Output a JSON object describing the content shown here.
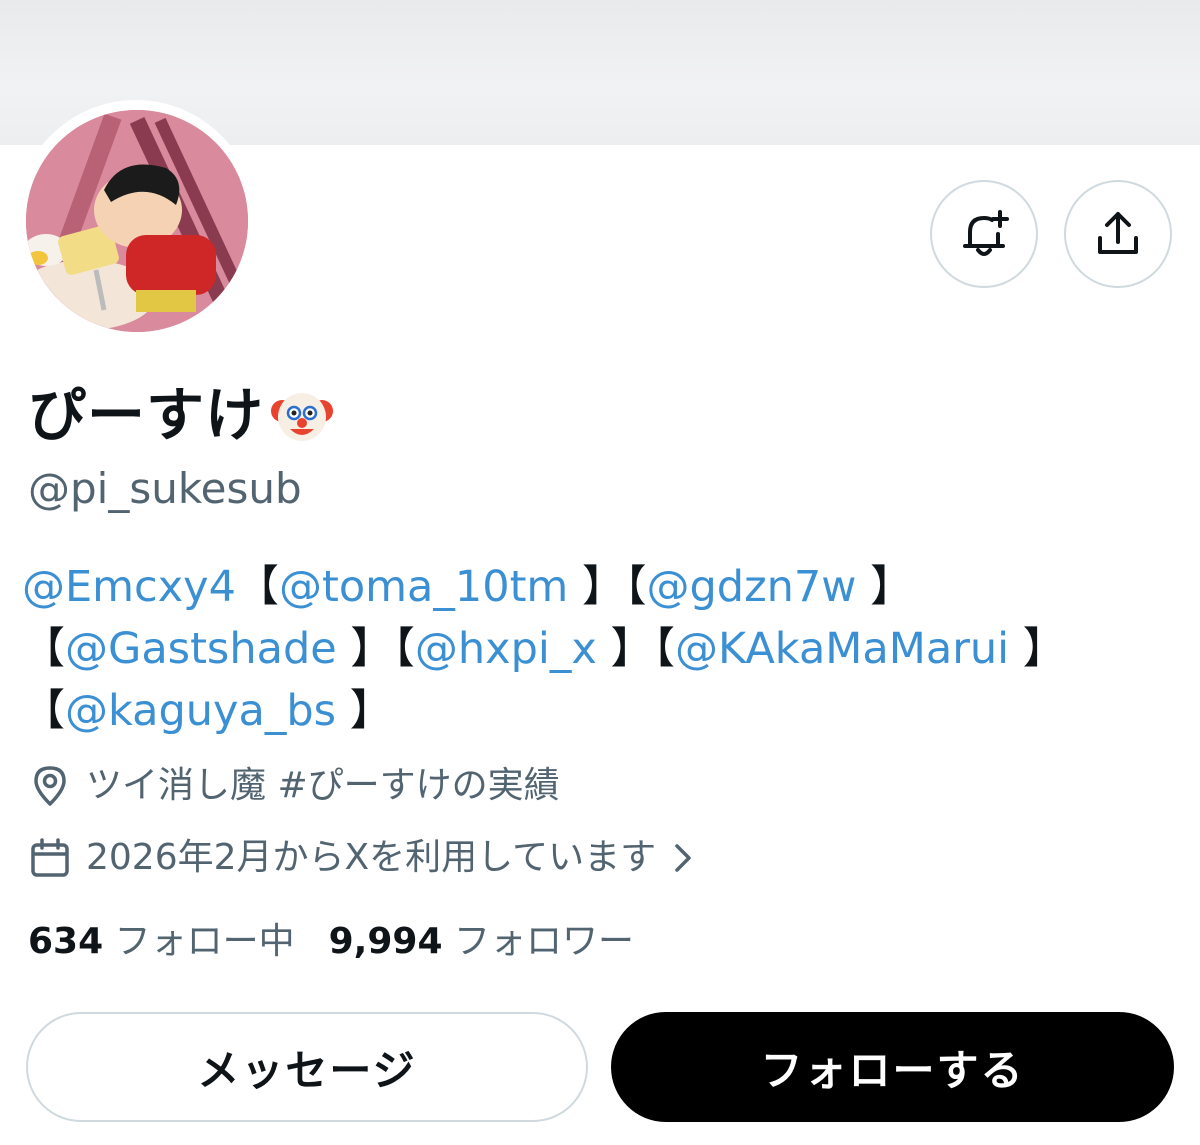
{
  "profile": {
    "display_name": "ぴーすけ",
    "display_emoji": "clown-face-emoji",
    "handle": "@pi_sukesub",
    "location": "ツイ消し魔 #ぴーすけの実績",
    "joined": "2026年2月からXを利用しています"
  },
  "bio": {
    "mentions": [
      "@Emcxy4",
      "@toma_10tm",
      "@gdzn7w",
      "@Gastshade",
      "@hxpi_x",
      "@KAkaMaMarui",
      "@kaguya_bs"
    ],
    "bracket_open": "【",
    "bracket_close": "】"
  },
  "stats": {
    "following_count": "634",
    "following_label": "フォロー中",
    "followers_count": "9,994",
    "followers_label": "フォロワー"
  },
  "actions": {
    "message_label": "メッセージ",
    "follow_label": "フォローする"
  },
  "icons": {
    "notify": "bell-plus-icon",
    "share": "share-upload-icon",
    "location": "map-pin-icon",
    "calendar": "calendar-icon",
    "chevron": "chevron-right-icon"
  },
  "colors": {
    "mention": "#3b8fd3",
    "secondary_text": "#536471",
    "follow_button": "#000000"
  }
}
